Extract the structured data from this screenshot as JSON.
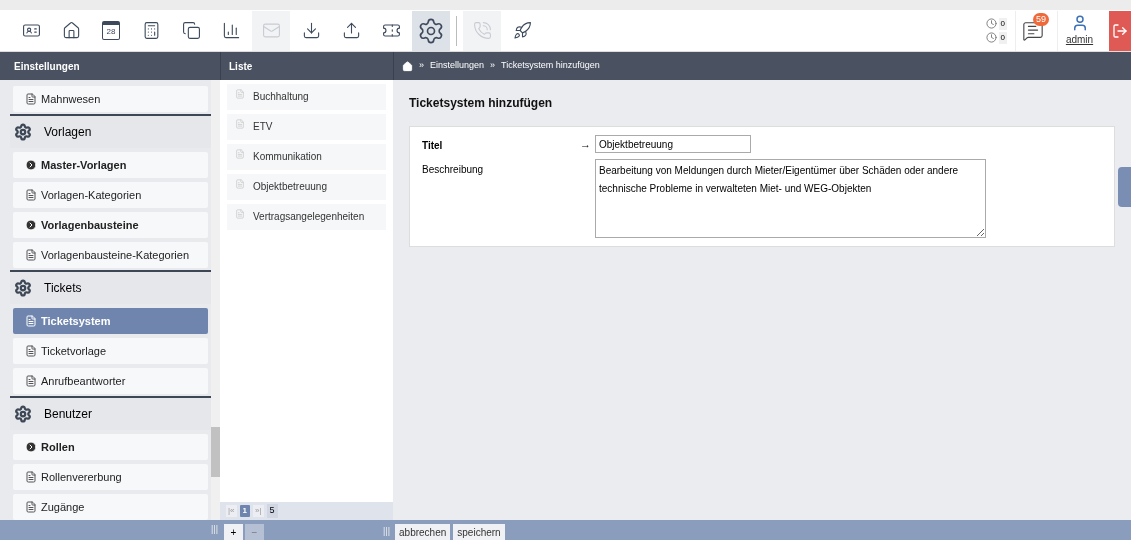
{
  "toolbar": {
    "buttons": [
      {
        "selected": false,
        "disabled": false
      },
      {
        "selected": false,
        "disabled": false
      },
      {
        "selected": false,
        "disabled": false,
        "day": "28"
      },
      {
        "selected": false,
        "disabled": false
      },
      {
        "selected": false,
        "disabled": false
      },
      {
        "selected": false,
        "disabled": false
      },
      {
        "selected": false,
        "disabled": true
      },
      {
        "selected": false,
        "disabled": false
      },
      {
        "selected": false,
        "disabled": false
      },
      {
        "selected": false,
        "disabled": false
      },
      {
        "selected": true,
        "disabled": false
      }
    ],
    "extra_buttons": [
      {
        "selected": false,
        "disabled": true
      },
      {
        "selected": false,
        "disabled": false
      }
    ],
    "counters": [
      "0",
      "0"
    ],
    "messages_badge": "59",
    "user": "admin"
  },
  "headers": {
    "sidebar": "Einstellungen",
    "list": "Liste",
    "breadcrumb": [
      "Einstellungen",
      "Ticketsystem hinzufügen"
    ],
    "separator": "»"
  },
  "sidebar": {
    "items": [
      {
        "kind": "page",
        "label": "Mahnwesen",
        "selected": false
      },
      {
        "kind": "group",
        "label": "Vorlagen",
        "selected": false
      },
      {
        "kind": "folder",
        "label": "Master-Vorlagen",
        "selected": false
      },
      {
        "kind": "page",
        "label": "Vorlagen-Kategorien",
        "selected": false
      },
      {
        "kind": "folder",
        "label": "Vorlagenbausteine",
        "selected": false
      },
      {
        "kind": "page",
        "label": "Vorlagenbausteine-Kategorien",
        "selected": false
      },
      {
        "kind": "group",
        "label": "Tickets",
        "selected": false
      },
      {
        "kind": "page",
        "label": "Ticketsystem",
        "selected": true
      },
      {
        "kind": "page",
        "label": "Ticketvorlage",
        "selected": false
      },
      {
        "kind": "page",
        "label": "Anrufbeantworter",
        "selected": false
      },
      {
        "kind": "group",
        "label": "Benutzer",
        "selected": false
      },
      {
        "kind": "folder",
        "label": "Rollen",
        "selected": false
      },
      {
        "kind": "page",
        "label": "Rollenvererbung",
        "selected": false
      },
      {
        "kind": "page",
        "label": "Zugänge",
        "selected": false
      }
    ]
  },
  "list": {
    "items": [
      {
        "label": "Buchhaltung",
        "selected": false
      },
      {
        "label": "ETV",
        "selected": false
      },
      {
        "label": "Kommunikation",
        "selected": false
      },
      {
        "label": "Objektbetreuung",
        "selected": false
      },
      {
        "label": "Vertragsangelegenheiten",
        "selected": false
      }
    ],
    "pagination": {
      "first": "|«",
      "pages": [
        {
          "label": "1",
          "selected": true
        }
      ],
      "last": "»|",
      "total": "5"
    },
    "add": "+",
    "remove": "−"
  },
  "form": {
    "heading": "Ticketsystem hinzufügen",
    "title_label": "Titel",
    "title_marker": "→",
    "title_value": "Objektbetreuung",
    "description_label": "Beschreibung",
    "description_value": "Bearbeitung von Meldungen durch Mieter/Eigentümer über Schäden oder andere technische Probleme in verwalteten Miet- und WEG-Objekten"
  },
  "actions": [
    "abbrechen",
    "speichern"
  ],
  "grips": [
    "|||",
    "|||"
  ]
}
